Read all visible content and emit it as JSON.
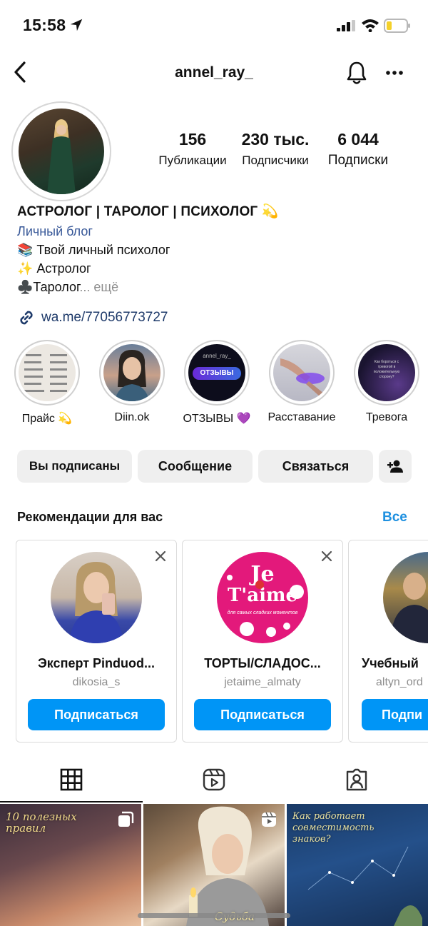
{
  "status_bar": {
    "time": "15:58"
  },
  "header": {
    "username": "annel_ray_"
  },
  "profile": {
    "stats": [
      {
        "value": "156",
        "label": "Публикации"
      },
      {
        "value": "230 тыс.",
        "label": "Подписчики"
      },
      {
        "value": "6 044",
        "label": "Подписки"
      }
    ],
    "bio": {
      "title": "АСТРОЛОГ | ТАРОЛОГ | ПСИХОЛОГ 💫",
      "category": "Личный блог",
      "line1": "📚 Твой личный психолог",
      "line2": "✨  Астролог",
      "line3": "♣️Таролог",
      "line3_more": "... ещё",
      "link": "wa.me/77056773727"
    }
  },
  "highlights": [
    {
      "label": "Прайс 💫"
    },
    {
      "label": "Diin.ok"
    },
    {
      "label": "ОТЗЫВЫ 💜",
      "badge_top": "annel_ray_",
      "badge_text": "ОТЗЫВЫ"
    },
    {
      "label": "Расставание"
    },
    {
      "label": "Тревога",
      "caption": "Как бороться с тревогой в положительную сторону?"
    }
  ],
  "actions": {
    "following": "Вы подписаны",
    "message": "Сообщение",
    "contact": "Связаться"
  },
  "recommendations": {
    "title": "Рекомендации для вас",
    "see_all": "Все",
    "cards": [
      {
        "name": "Эксперт Pinduod...",
        "handle": "dikosia_s",
        "button": "Подписаться"
      },
      {
        "name": "ТОРТЫ/СЛАДОС...",
        "handle": "jetaime_almaty",
        "button": "Подписаться",
        "logo_text_1": "Je",
        "logo_text_2": "T'aime",
        "logo_sub": "для самых сладких моментов"
      },
      {
        "name": "Учебный",
        "handle": "altyn_ord",
        "button": "Подпи"
      }
    ]
  },
  "posts": [
    {
      "caption": "10 полезных правил"
    },
    {
      "caption": "Судьба"
    },
    {
      "caption": "Как работает совместимость знаков?"
    }
  ],
  "colors": {
    "link": "#1e3a6a",
    "accent": "#0095f6",
    "see_all": "#1e90e0"
  }
}
